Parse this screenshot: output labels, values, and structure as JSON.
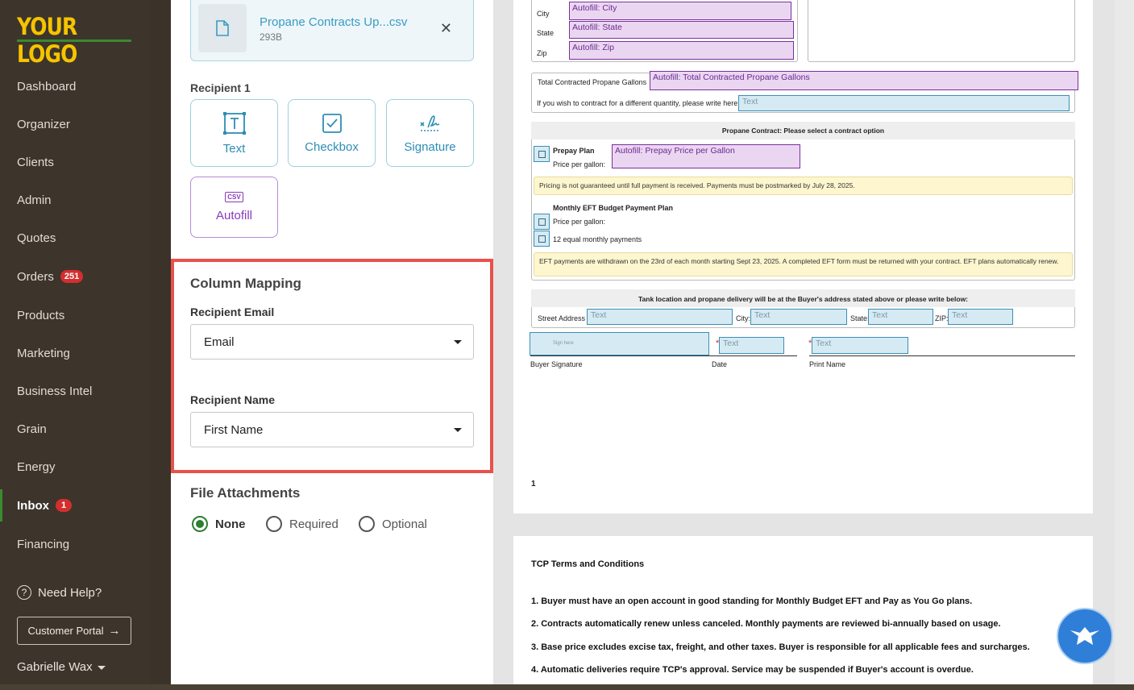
{
  "sidebar": {
    "logo": "YOUR LOGO",
    "items": [
      {
        "label": "Dashboard"
      },
      {
        "label": "Organizer"
      },
      {
        "label": "Clients"
      },
      {
        "label": "Admin"
      },
      {
        "label": "Quotes"
      },
      {
        "label": "Orders",
        "badge": "251"
      },
      {
        "label": "Products"
      },
      {
        "label": "Marketing"
      },
      {
        "label": "Business Intel"
      },
      {
        "label": "Grain"
      },
      {
        "label": "Energy"
      },
      {
        "label": "Inbox",
        "badge": "1",
        "active": true
      },
      {
        "label": "Financing"
      }
    ],
    "help": "Need Help?",
    "portal_button": "Customer Portal",
    "user": "Gabrielle Wax"
  },
  "panel": {
    "file": {
      "name": "Propane Contracts Up...csv",
      "size": "293B"
    },
    "recipient_label": "Recipient 1",
    "tools": {
      "text": "Text",
      "checkbox": "Checkbox",
      "signature": "Signature",
      "autofill": "Autofill",
      "csv_badge": "CSV"
    },
    "column_mapping": {
      "title": "Column Mapping",
      "email_label": "Recipient Email",
      "email_value": "Email",
      "name_label": "Recipient Name",
      "name_value": "First Name"
    },
    "attachments": {
      "title": "File Attachments",
      "options": [
        "None",
        "Required",
        "Optional"
      ],
      "selected": "None"
    }
  },
  "document": {
    "labels": {
      "city": "City",
      "state": "State",
      "zip": "Zip"
    },
    "autofill": {
      "city": "Autofill: City",
      "state": "Autofill: State",
      "zip": "Autofill: Zip",
      "gallons": "Autofill: Total Contracted Propane Gallons",
      "prepay": "Autofill: Prepay Price per Gallon"
    },
    "gallons_label": "Total Contracted Propane Gallons",
    "different_qty": "If you wish to contract for a different quantity, please write here:",
    "text_placeholder": "Text",
    "contract_header": "Propane Contract: Please select a contract option",
    "prepay_plan": "Prepay Plan",
    "price_per_gallon": "Price per gallon:",
    "prepay_note": "Pricing is not guaranteed until full payment is received. Payments must be postmarked by July 28, 2025.",
    "eft_plan": "Monthly EFT Budget Payment Plan",
    "eft_payments": "12 equal monthly payments",
    "eft_note": "EFT payments are withdrawn on the 23rd of each month starting Sept 23, 2025. A completed EFT form must be returned with your contract. EFT plans automatically renew.",
    "tank_header": "Tank location and propane delivery will be at the Buyer's address stated above or please write below:",
    "street": "Street Address",
    "city2": "City:",
    "state2": "State:",
    "zip2": "ZIP:",
    "sign_here": "Sign here",
    "buyer_signature": "Buyer Signature",
    "date": "Date",
    "print_name": "Print Name",
    "page_number": "1",
    "terms_title": "TCP Terms and Conditions",
    "terms": [
      "1. Buyer must have an open account in good standing for Monthly Budget EFT and Pay as You Go plans.",
      "2. Contracts automatically renew unless canceled. Monthly payments are reviewed bi-annually based on usage.",
      "3. Base price excludes excise tax, freight, and other taxes. Buyer is responsible for all applicable fees and surcharges.",
      "4. Automatic deliveries require TCP's approval. Service may be suspended if Buyer's account is overdue."
    ]
  },
  "colors": {
    "accent_blue": "#3a9cc0",
    "autofill_purple": "#8a3ab9",
    "highlight_red": "#e8524a",
    "sidebar_bg": "#3d342b",
    "logo_yellow": "#f5c400"
  }
}
